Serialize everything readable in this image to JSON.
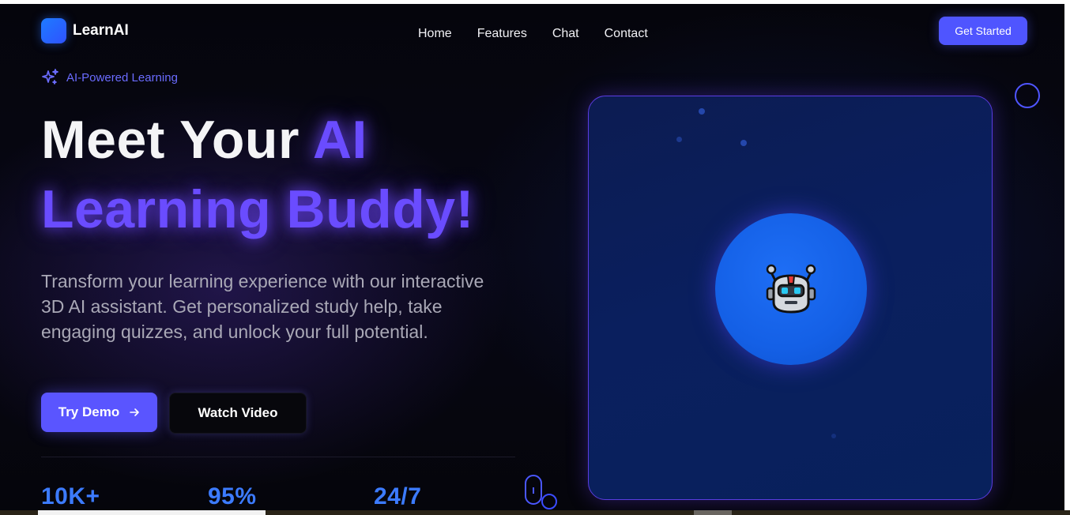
{
  "header": {
    "brand": "LearnAI",
    "nav": [
      "Home",
      "Features",
      "Chat",
      "Contact"
    ],
    "cta": "Get Started"
  },
  "hero": {
    "badge": "AI-Powered Learning",
    "title_line1_white": "Meet Your ",
    "title_line1_accent": "AI",
    "title_line2": "Learning Buddy!",
    "description": "Transform your learning experience with our interactive 3D AI assistant. Get personalized study help, take engaging quizzes, and unlock your full potential.",
    "primary_button": "Try Demo",
    "primary_button_icon": "arrow-right-icon",
    "secondary_button": "Watch Video"
  },
  "stats": [
    "10K+",
    "95%",
    "24/7"
  ],
  "assistant_card": {
    "avatar_icon": "robot-icon"
  },
  "colors": {
    "accent": "#5a55ff",
    "purple_text": "#6a4cff",
    "stat_blue": "#3c7bff",
    "background": "#05050c",
    "card_border": "#5b3ce0",
    "orb": "#1460e6"
  }
}
